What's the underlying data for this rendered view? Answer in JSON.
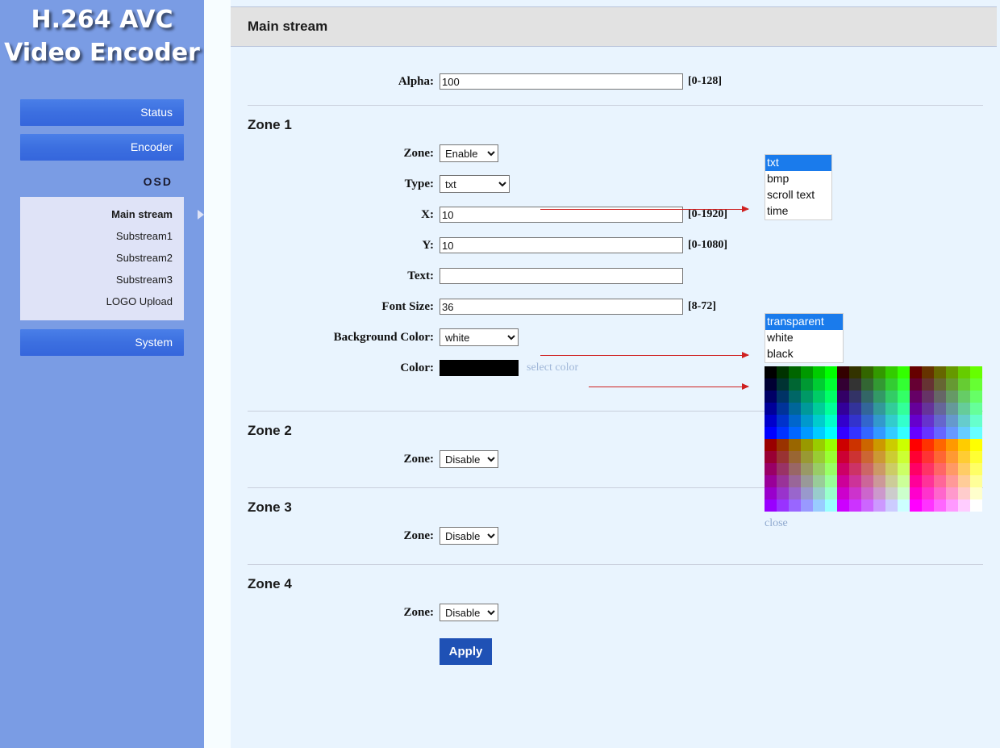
{
  "brand": {
    "line1": "H.264 AVC",
    "line2": "Video Encoder"
  },
  "sidebar": {
    "buttons": [
      {
        "label": "Status",
        "name": "status"
      },
      {
        "label": "Encoder",
        "name": "encoder"
      }
    ],
    "section_label": "OSD",
    "subitems": [
      {
        "label": "Main stream",
        "active": true
      },
      {
        "label": "Substream1",
        "active": false
      },
      {
        "label": "Substream2",
        "active": false
      },
      {
        "label": "Substream3",
        "active": false
      },
      {
        "label": "LOGO Upload",
        "active": false
      }
    ],
    "system_label": "System"
  },
  "header": {
    "title": "Main stream"
  },
  "form": {
    "alpha": {
      "label": "Alpha:",
      "value": "100",
      "hint": "[0-128]"
    },
    "zone1": {
      "heading": "Zone 1",
      "zone": {
        "label": "Zone:",
        "value": "Enable",
        "options": [
          "Enable",
          "Disable"
        ]
      },
      "type": {
        "label": "Type:",
        "value": "txt",
        "options": [
          "txt",
          "bmp",
          "scroll text",
          "time"
        ]
      },
      "x": {
        "label": "X:",
        "value": "10",
        "hint": "[0-1920]"
      },
      "y": {
        "label": "Y:",
        "value": "10",
        "hint": "[0-1080]"
      },
      "text": {
        "label": "Text:",
        "value": "",
        "placeholder": ""
      },
      "font_size": {
        "label": "Font Size:",
        "value": "36",
        "hint": "[8-72]"
      },
      "background_color": {
        "label": "Background Color:",
        "value": "white",
        "options": [
          "transparent",
          "white",
          "black"
        ]
      },
      "color": {
        "label": "Color:",
        "swatch": "#000000",
        "link_label": "select color"
      }
    },
    "zone2": {
      "heading": "Zone 2",
      "zone": {
        "label": "Zone:",
        "value": "Disable",
        "options": [
          "Enable",
          "Disable"
        ]
      }
    },
    "zone3": {
      "heading": "Zone 3",
      "zone": {
        "label": "Zone:",
        "value": "Disable",
        "options": [
          "Enable",
          "Disable"
        ]
      }
    },
    "zone4": {
      "heading": "Zone 4",
      "zone": {
        "label": "Zone:",
        "value": "Disable",
        "options": [
          "Enable",
          "Disable"
        ]
      }
    },
    "apply_label": "Apply"
  },
  "popups": {
    "type_options": {
      "items": [
        "txt",
        "bmp",
        "scroll text",
        "time"
      ],
      "selected": "txt"
    },
    "bg_options": {
      "items": [
        "transparent",
        "white",
        "black"
      ],
      "selected": "transparent"
    }
  },
  "color_picker": {
    "close_label": "close",
    "red_levels_row1": [
      "00",
      "33",
      "66"
    ],
    "red_levels_row2": [
      "99",
      "CC",
      "FF"
    ],
    "green_levels": [
      "00",
      "33",
      "66",
      "99",
      "CC",
      "FF"
    ],
    "blue_levels": [
      "00",
      "33",
      "66",
      "99",
      "CC",
      "FF"
    ]
  },
  "theme": {
    "sidebar_bg": "#7a9ce4",
    "nav_button": "#3c6fe0",
    "subnav_bg": "#dfe3f7",
    "panel_bg": "#e9f4fe",
    "titlebar_bg": "#e2e2e2",
    "apply_bg": "#1f51b5",
    "arrow": "#cf2020",
    "link": "#9fb6d8",
    "highlight": "#1a7bec"
  }
}
